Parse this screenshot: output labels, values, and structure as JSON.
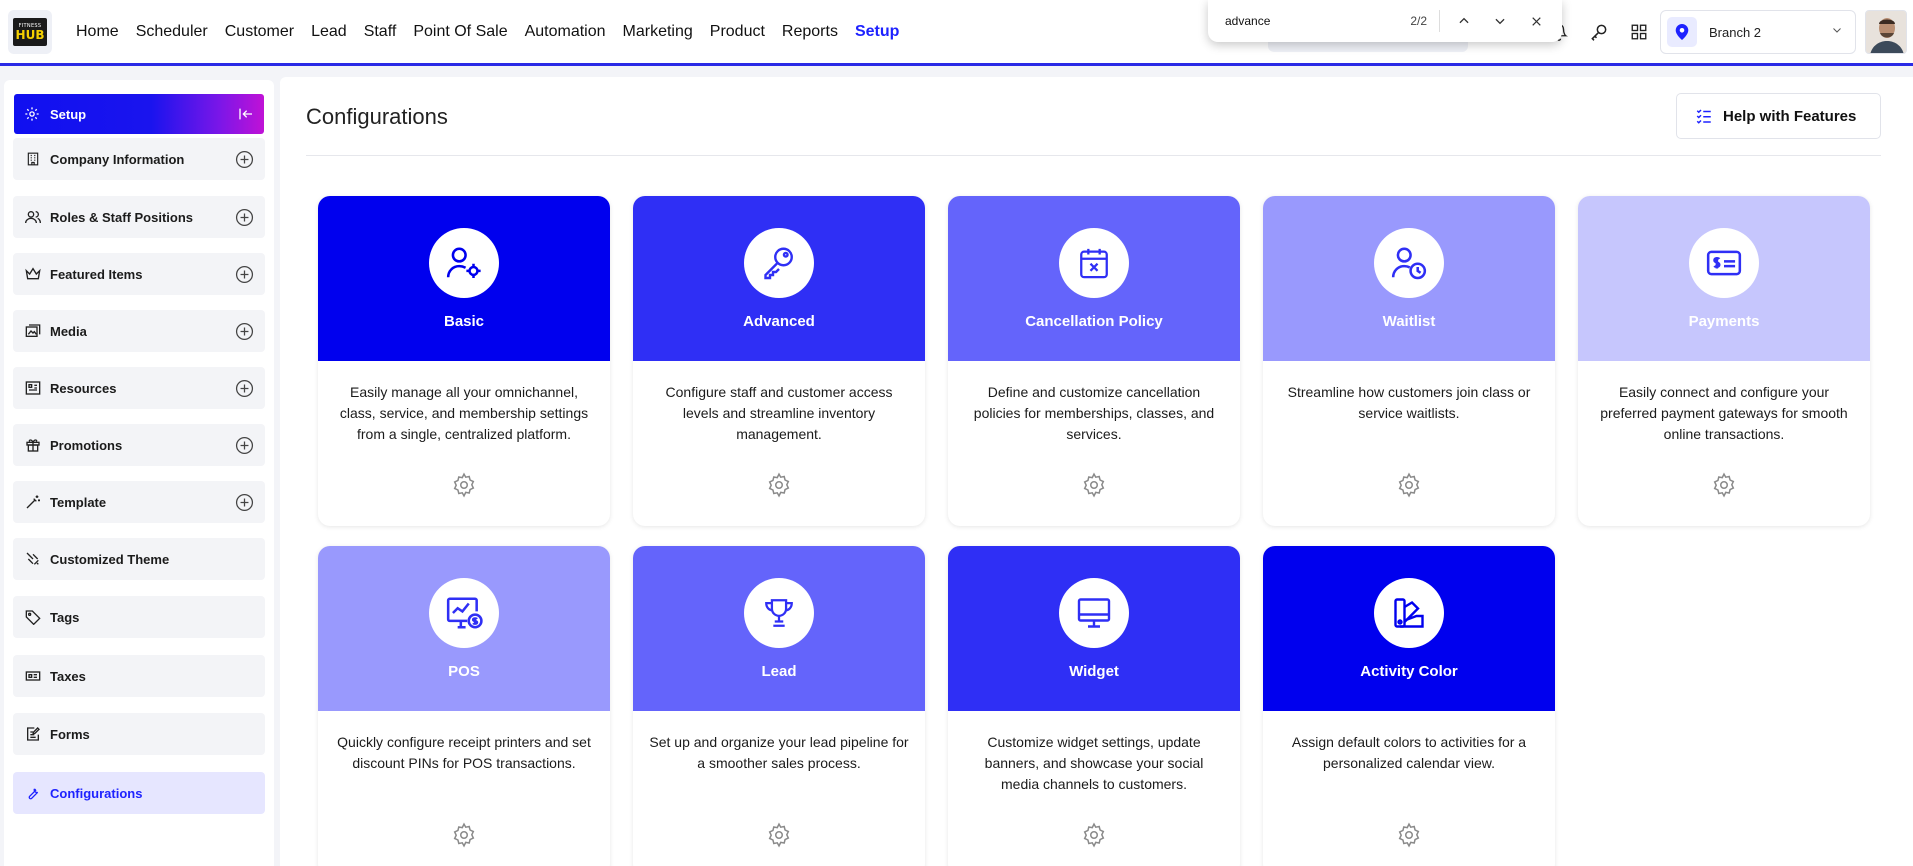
{
  "brand": {
    "logo_top": "FITNESS",
    "logo_main": "HUB"
  },
  "nav": {
    "items": [
      "Home",
      "Scheduler",
      "Customer",
      "Lead",
      "Staff",
      "Point Of Sale",
      "Automation",
      "Marketing",
      "Product",
      "Reports",
      "Setup"
    ],
    "active": "Setup"
  },
  "find_bar": {
    "query": "advance",
    "count": "2/2"
  },
  "branch": {
    "label": "Branch 2"
  },
  "sidebar": {
    "header": "Setup",
    "items": [
      {
        "label": "Company Information",
        "icon": "building-icon",
        "expandable": true
      },
      {
        "label": "Roles & Staff Positions",
        "icon": "users-icon",
        "expandable": true
      },
      {
        "label": "Featured Items",
        "icon": "crown-icon",
        "expandable": true
      },
      {
        "label": "Media",
        "icon": "media-icon",
        "expandable": true
      },
      {
        "label": "Resources",
        "icon": "resources-icon",
        "expandable": true
      },
      {
        "label": "Promotions",
        "icon": "gift-icon",
        "expandable": true
      },
      {
        "label": "Template",
        "icon": "magic-wand-icon",
        "expandable": true
      },
      {
        "label": "Customized Theme",
        "icon": "brush-icon",
        "expandable": false
      },
      {
        "label": "Tags",
        "icon": "tag-icon",
        "expandable": false
      },
      {
        "label": "Taxes",
        "icon": "taxes-icon",
        "expandable": false
      },
      {
        "label": "Forms",
        "icon": "form-icon",
        "expandable": false
      },
      {
        "label": "Configurations",
        "icon": "wrench-icon",
        "expandable": false,
        "active": true
      }
    ]
  },
  "main": {
    "title": "Configurations",
    "help_button": "Help with Features",
    "cards": [
      {
        "title": "Basic",
        "desc": "Easily manage all your omnichannel, class, service, and membership settings from a single, centralized platform.",
        "color": "#0000ee",
        "icon": "user-gear-icon"
      },
      {
        "title": "Advanced",
        "desc": "Configure staff and customer access levels and streamline inventory management.",
        "color": "#2f2ff5",
        "icon": "key-icon"
      },
      {
        "title": "Cancellation Policy",
        "desc": "Define and customize cancellation policies for memberships, classes, and services.",
        "color": "#6464fb",
        "icon": "calendar-x-icon"
      },
      {
        "title": "Waitlist",
        "desc": "Streamline how customers join class or service waitlists.",
        "color": "#9999fd",
        "icon": "user-clock-icon"
      },
      {
        "title": "Payments",
        "desc": "Easily connect and configure your preferred payment gateways for smooth online transactions.",
        "color": "#c6c6fd",
        "icon": "payment-card-icon"
      },
      {
        "title": "POS",
        "desc": "Quickly configure receipt printers and set discount PINs for POS transactions.",
        "color": "#9999fd",
        "icon": "monitor-dollar-icon"
      },
      {
        "title": "Lead",
        "desc": "Set up and organize your lead pipeline for a smoother sales process.",
        "color": "#6464fb",
        "icon": "trophy-icon"
      },
      {
        "title": "Widget",
        "desc": "Customize widget settings, update banners, and showcase your social media channels to customers.",
        "color": "#2f2ff5",
        "icon": "monitor-icon"
      },
      {
        "title": "Activity Color",
        "desc": "Assign default colors to activities for a personalized calendar view.",
        "color": "#0000ee",
        "icon": "palette-icon"
      }
    ]
  }
}
